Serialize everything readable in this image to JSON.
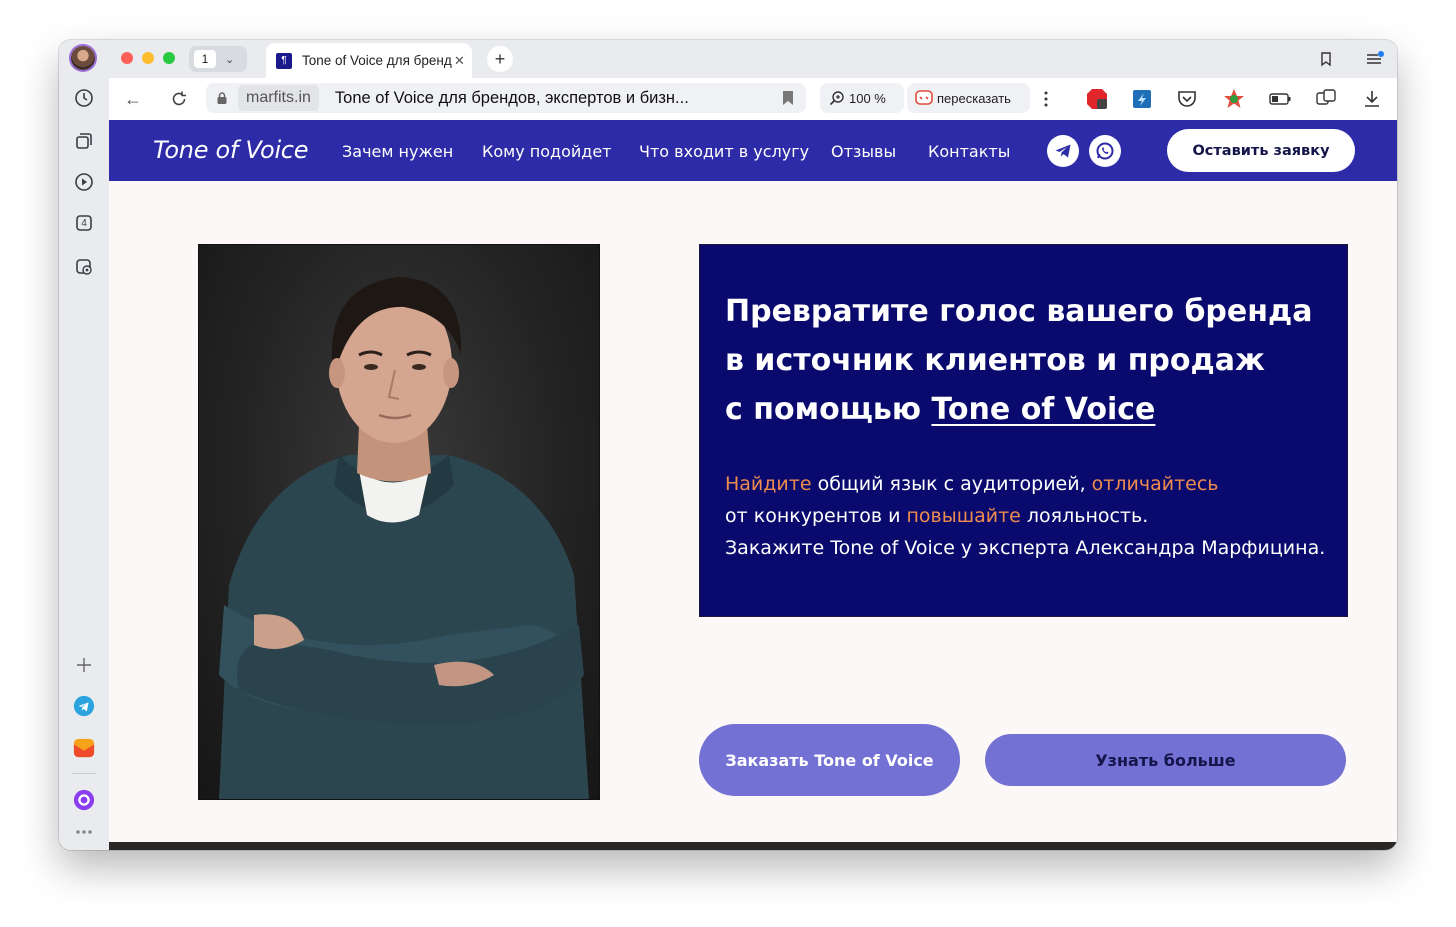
{
  "browser": {
    "tab_count": "1",
    "tab_title": "Tone of Voice для брендов, экспертов и бизн",
    "tab_favicon": "¶",
    "domain": "marfits.in",
    "page_title": "Tone of Voice для брендов, экспертов и бизн...",
    "zoom": "100 %",
    "retell_label": "пересказать",
    "sidebar_badge": "4"
  },
  "site": {
    "logo": "Tone of Voice",
    "nav": [
      "Зачем нужен",
      "Кому подойдет",
      "Что входит в услугу",
      "Отзывы",
      "Контакты"
    ],
    "cta_top": "Оставить заявку"
  },
  "hero": {
    "title_line1": "Превратите голос вашего бренда",
    "title_line2": "в источник клиентов и продаж",
    "title_line3_prefix": "с помощью ",
    "title_line3_link": "Tone of Voice",
    "sub_highlight1": "Найдите",
    "sub_text1": " общий язык с аудиторией, ",
    "sub_highlight2": "отличайтесь",
    "sub_text2": "от конкурентов и ",
    "sub_highlight3": "повышайте",
    "sub_text3": " лояльность.",
    "sub_line3": "Закажите Tone of Voice у эксперта Александра Марфицина.",
    "button_primary": "Заказать Tone of Voice",
    "button_secondary": "Узнать больше"
  },
  "colors": {
    "nav_bg": "#2d2ba7",
    "hero_card_bg": "#0a0a6e",
    "accent_orange": "#ee8b4e",
    "button_bg": "#7371d4"
  }
}
